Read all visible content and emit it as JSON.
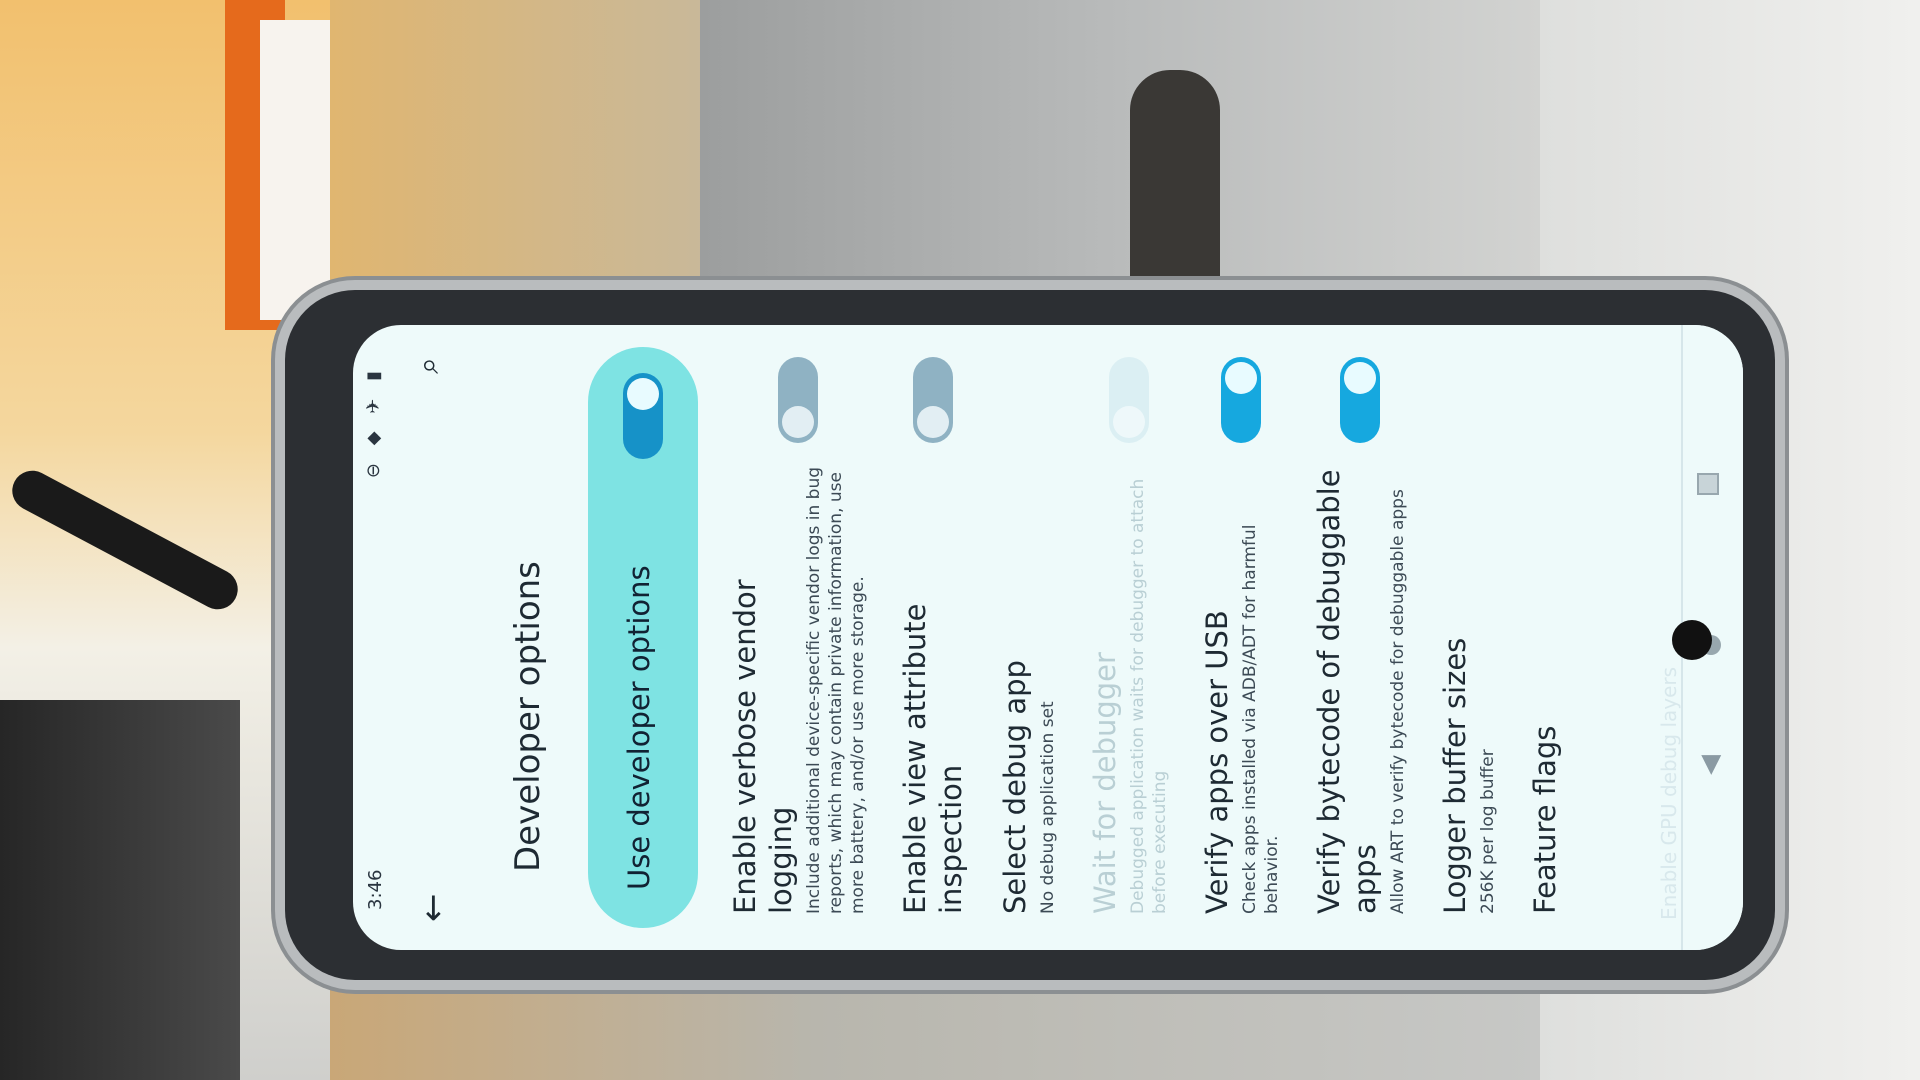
{
  "status": {
    "time": "3:46",
    "icons": "⊖ ◆ ✈ ▮"
  },
  "header": {
    "back_icon": "←",
    "search_icon": "⌕",
    "title": "Developer options"
  },
  "master": {
    "label": "Use developer options",
    "enabled": true
  },
  "settings": [
    {
      "title": "Enable verbose vendor logging",
      "subtitle": "Include additional device-specific vendor logs in bug reports, which may contain private information, use more battery, and/or use more storage.",
      "state": "off",
      "disabled": false
    },
    {
      "title": "Enable view attribute inspection",
      "subtitle": "",
      "state": "off",
      "disabled": false
    },
    {
      "title": "Select debug app",
      "subtitle": "No debug application set",
      "state": null,
      "disabled": false
    },
    {
      "title": "Wait for debugger",
      "subtitle": "Debugged application waits for debugger to attach before executing",
      "state": "off",
      "disabled": true
    },
    {
      "title": "Verify apps over USB",
      "subtitle": "Check apps installed via ADB/ADT for harmful behavior.",
      "state": "on",
      "disabled": false
    },
    {
      "title": "Verify bytecode of debuggable apps",
      "subtitle": "Allow ART to verify bytecode for debuggable apps",
      "state": "on",
      "disabled": false
    },
    {
      "title": "Logger buffer sizes",
      "subtitle": "256K per log buffer",
      "state": null,
      "disabled": false
    },
    {
      "title": "Feature flags",
      "subtitle": "",
      "state": null,
      "disabled": false
    }
  ],
  "nav": {
    "back": "◀",
    "ghost_text": "Enable GPU debug layers"
  }
}
